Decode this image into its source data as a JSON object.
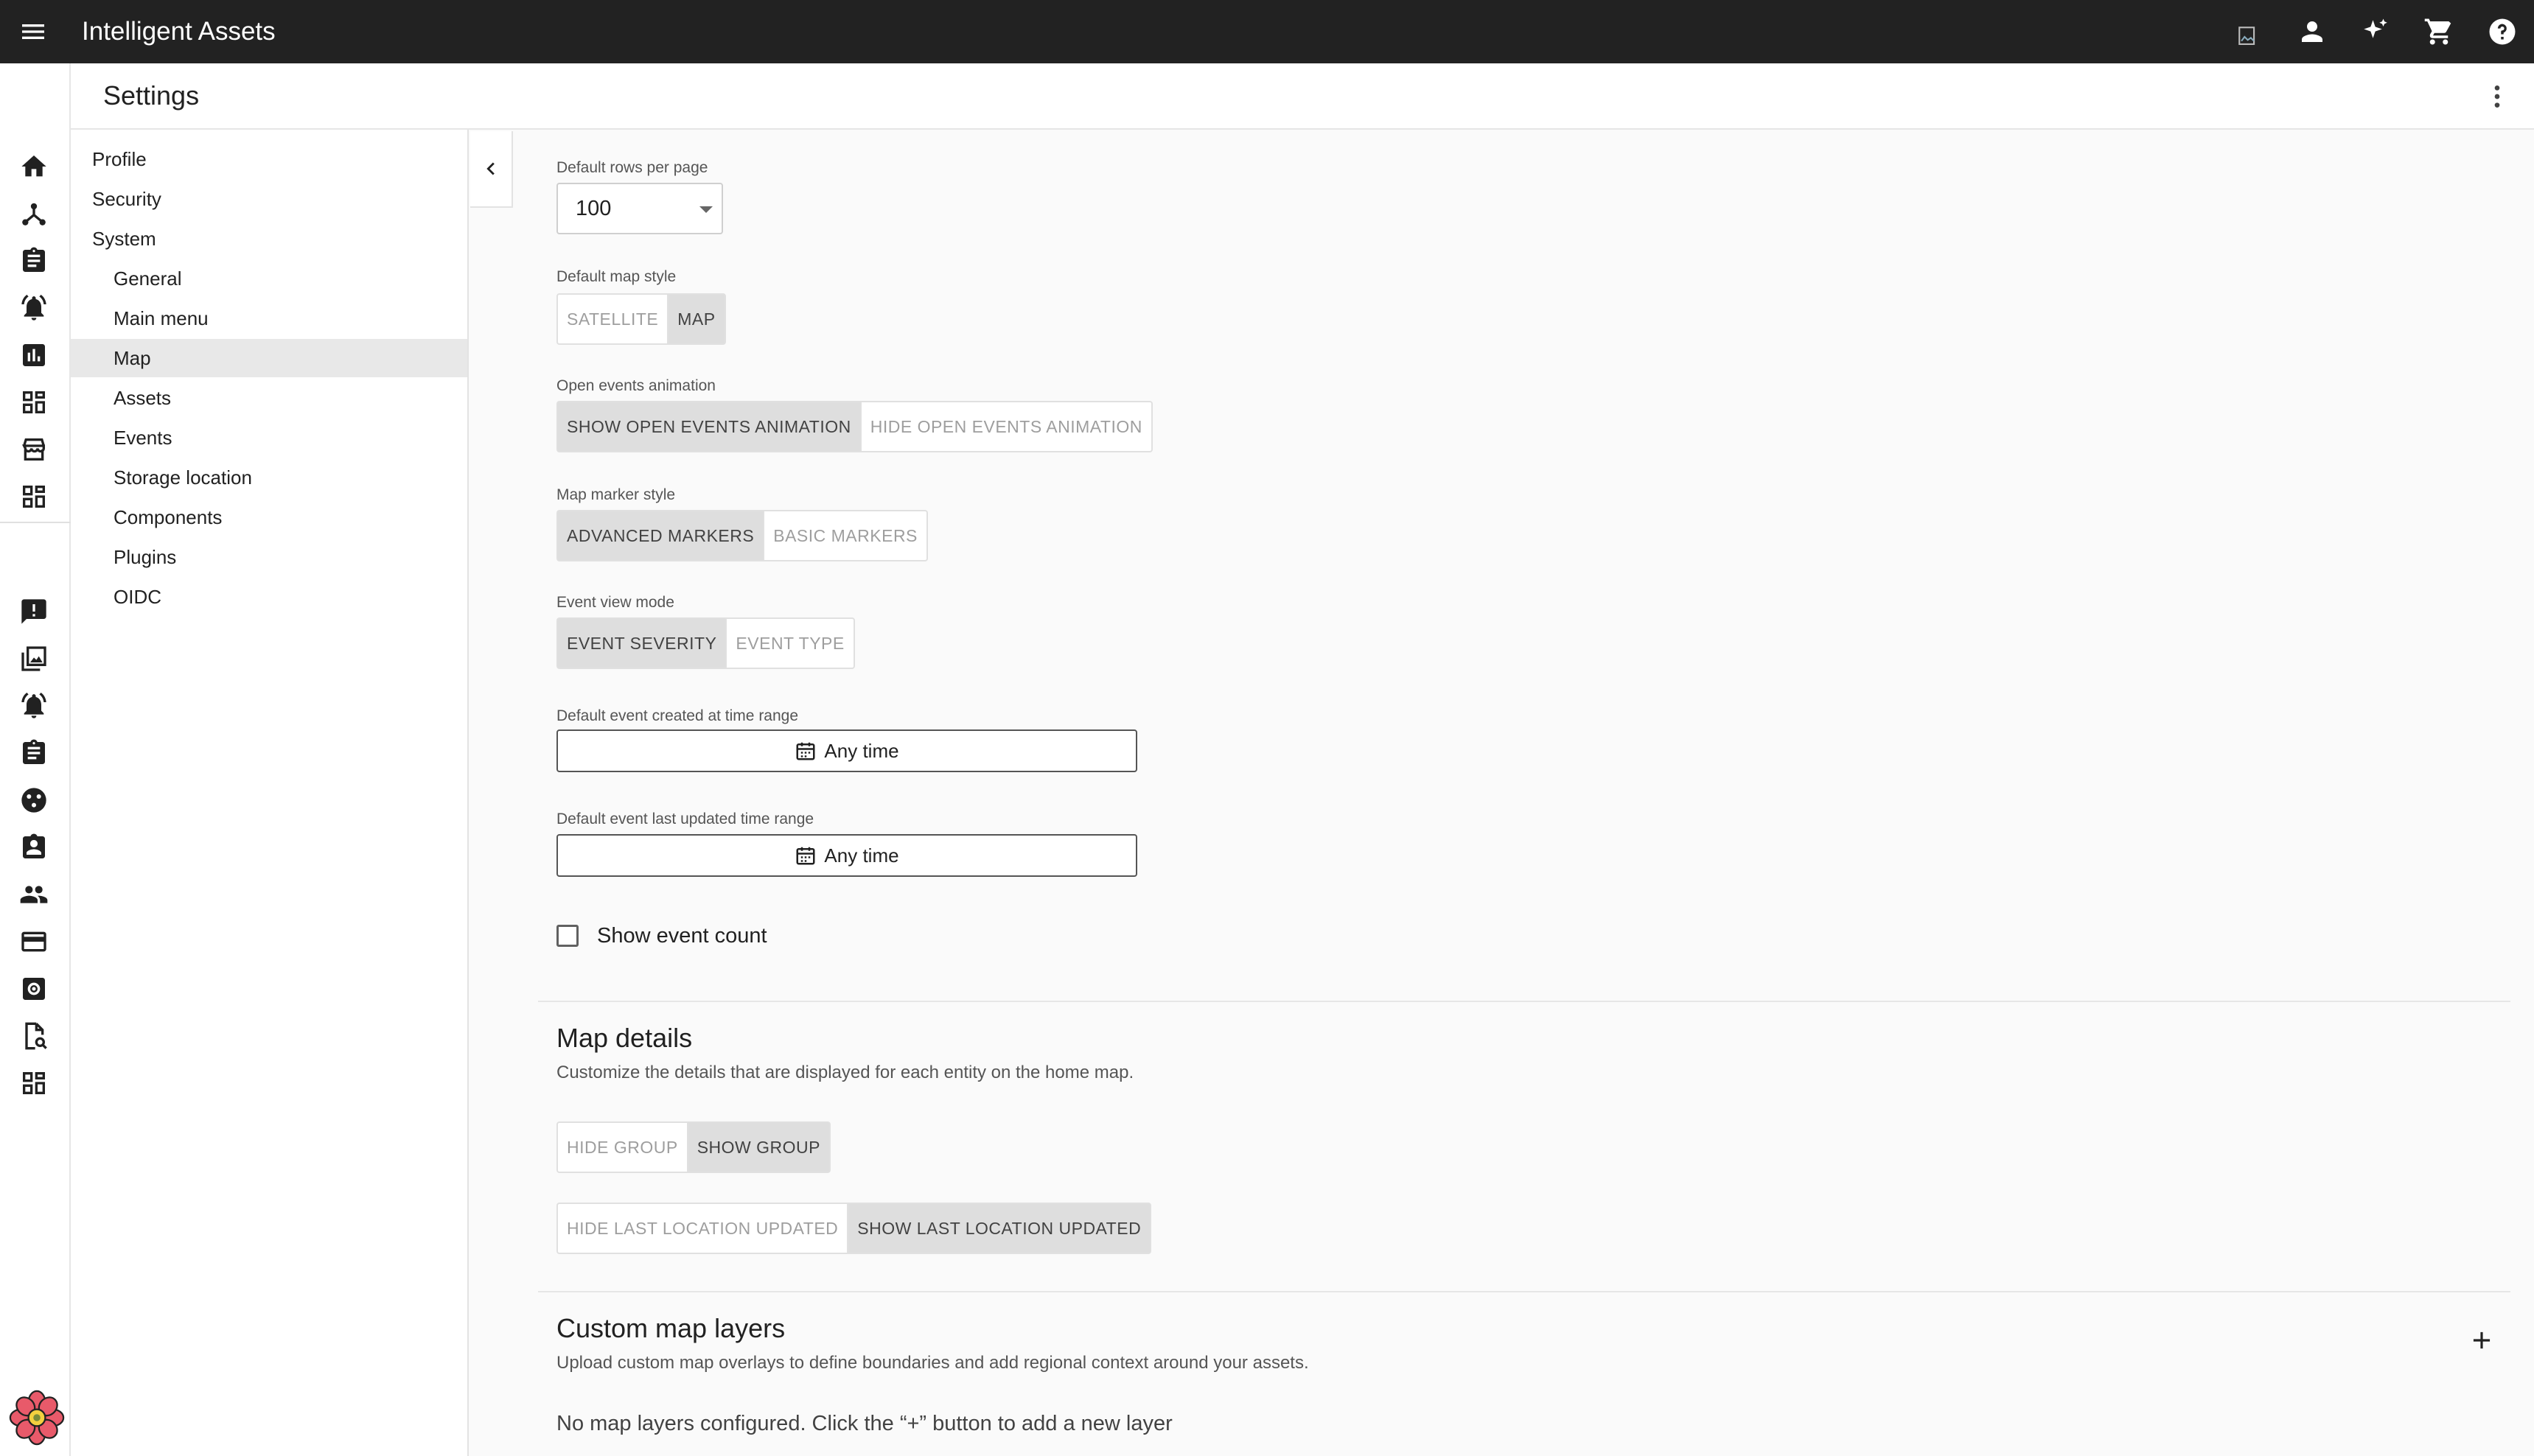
{
  "app": {
    "title": "Intelligent Assets",
    "menu_icon": "menu-icon",
    "actions": [
      "broken-image-icon",
      "account-icon",
      "sparkle-icon",
      "cart-icon",
      "help-icon"
    ]
  },
  "header": {
    "title": "Settings",
    "more_icon": "more-vert-icon"
  },
  "rail": {
    "icons": [
      "home-icon",
      "hierarchy-icon",
      "clipboard-icon",
      "alarm-bell-icon",
      "bar-chart-icon",
      "dashboard-icon",
      "store-icon",
      "dashboard-icon",
      "report-icon",
      "image-gallery-icon",
      "alarm-bell-icon",
      "clipboard-icon",
      "palette-icon",
      "badge-icon",
      "people-icon",
      "credit-card-icon",
      "settings-box-icon",
      "doc-search-icon",
      "dashboard-icon"
    ]
  },
  "nav": {
    "items": [
      {
        "label": "Profile",
        "level": 1
      },
      {
        "label": "Security",
        "level": 1
      },
      {
        "label": "System",
        "level": 1
      },
      {
        "label": "General",
        "level": 2
      },
      {
        "label": "Main menu",
        "level": 2
      },
      {
        "label": "Map",
        "level": 2,
        "active": true
      },
      {
        "label": "Assets",
        "level": 2
      },
      {
        "label": "Events",
        "level": 2
      },
      {
        "label": "Storage location",
        "level": 2
      },
      {
        "label": "Components",
        "level": 2
      },
      {
        "label": "Plugins",
        "level": 2
      },
      {
        "label": "OIDC",
        "level": 2
      }
    ]
  },
  "form": {
    "rows_per_page": {
      "label": "Default rows per page",
      "value": "100"
    },
    "map_style": {
      "label": "Default map style",
      "options": [
        "SATELLITE",
        "MAP"
      ],
      "selected": "MAP"
    },
    "open_events_animation": {
      "label": "Open events animation",
      "options": [
        "SHOW OPEN EVENTS ANIMATION",
        "HIDE OPEN EVENTS ANIMATION"
      ],
      "selected": "SHOW OPEN EVENTS ANIMATION"
    },
    "marker_style": {
      "label": "Map marker style",
      "options": [
        "ADVANCED MARKERS",
        "BASIC MARKERS"
      ],
      "selected": "ADVANCED MARKERS"
    },
    "event_view_mode": {
      "label": "Event view mode",
      "options": [
        "EVENT SEVERITY",
        "EVENT TYPE"
      ],
      "selected": "EVENT SEVERITY"
    },
    "created_range": {
      "label": "Default event created at time range",
      "value": "Any time"
    },
    "updated_range": {
      "label": "Default event last updated time range",
      "value": "Any time"
    },
    "show_event_count": {
      "label": "Show event count",
      "checked": false
    }
  },
  "map_details": {
    "title": "Map details",
    "description": "Customize the details that are displayed for each entity on the home map.",
    "group_toggle": {
      "options": [
        "HIDE GROUP",
        "SHOW GROUP"
      ],
      "selected": "SHOW GROUP"
    },
    "location_toggle": {
      "options": [
        "HIDE LAST LOCATION UPDATED",
        "SHOW LAST LOCATION UPDATED"
      ],
      "selected": "SHOW LAST LOCATION UPDATED"
    }
  },
  "custom_layers": {
    "title": "Custom map layers",
    "description": "Upload custom map overlays to define boundaries and add regional context around your assets.",
    "empty": "No map layers configured. Click the “+” button to add a new layer"
  },
  "colors": {
    "appbar": "#222222",
    "selected_toggle": "#dedede",
    "nav_active": "#e8e8e8"
  }
}
